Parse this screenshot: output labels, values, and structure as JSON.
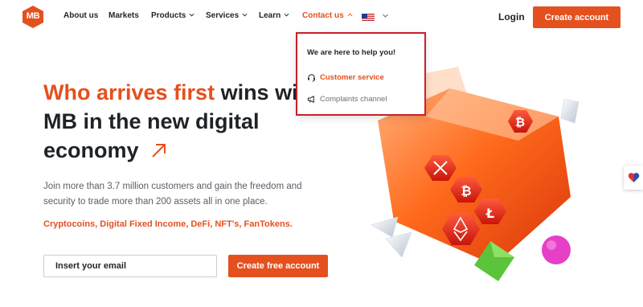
{
  "brand": {
    "logo_text": "MB",
    "accent_color": "#e4501e"
  },
  "nav": {
    "items": [
      {
        "label": "About us",
        "has_dropdown": false
      },
      {
        "label": "Markets",
        "has_dropdown": false
      },
      {
        "label": "Products",
        "has_dropdown": true
      },
      {
        "label": "Services",
        "has_dropdown": true
      },
      {
        "label": "Learn",
        "has_dropdown": true
      },
      {
        "label": "Contact us",
        "has_dropdown": true,
        "active": true
      }
    ],
    "language_flag": "us-flag-icon",
    "login_label": "Login",
    "create_account_label": "Create account"
  },
  "contact_dropdown": {
    "title": "We are here to help you!",
    "items": [
      {
        "label": "Customer service",
        "icon": "headset-icon"
      },
      {
        "label": "Complaints channel",
        "icon": "megaphone-icon"
      }
    ],
    "border_color": "#c8202a"
  },
  "hero": {
    "headline_accent": "Who arrives first",
    "headline_rest_line1": " wins with",
    "headline_line2": "MB in the new digital",
    "headline_line3": "economy",
    "subtext": "Join more than 3.7 million customers and gain the freedom and security to trade more than 200 assets all in one place.",
    "tagline": "Cryptocoins, Digital Fixed Income, DeFi, NFT's, FanTokens.",
    "email_placeholder": "Insert your email",
    "cta_label": "Create free account"
  },
  "side_badge": {
    "icon": "heart-badge-icon"
  }
}
